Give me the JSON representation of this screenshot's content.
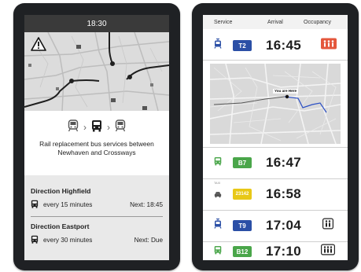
{
  "left_screen": {
    "clock": "18:30",
    "message": "Rail replacement bus services between Newhaven and Crossways",
    "directions": [
      {
        "title": "Direction Highfield",
        "frequency": "every 15 minutes",
        "next": "Next: 18:45"
      },
      {
        "title": "Direction Eastport",
        "frequency": "every 30 minutes",
        "next": "Next: Due"
      }
    ]
  },
  "right_screen": {
    "header": {
      "service": "Service",
      "arrival": "Arrival",
      "occupancy": "Occupancy"
    },
    "map_label": "You are Here",
    "rows": [
      {
        "mode": "tram-icon",
        "line": "T2",
        "time": "16:45",
        "occupancy": "high-occupancy-icon",
        "badge_color": "#2b4fa6"
      },
      {
        "mode": "bus-icon",
        "line": "B7",
        "time": "16:47",
        "occupancy": "",
        "badge_color": "#4aa64a"
      },
      {
        "mode": "taxi-icon",
        "line": "23142",
        "time": "16:58",
        "occupancy": "",
        "badge_color": "#e8c817",
        "mode_label": "TAXI"
      },
      {
        "mode": "tram-icon",
        "line": "T9",
        "time": "17:04",
        "occupancy": "medium-occupancy-icon",
        "badge_color": "#2b4fa6"
      },
      {
        "mode": "bus-icon",
        "line": "B12",
        "time": "17:10",
        "occupancy": "low-occupancy-icon",
        "badge_color": "#4aa64a"
      }
    ]
  },
  "colors": {
    "tram_blue": "#2b4fa6",
    "bus_green": "#4aa64a",
    "taxi_yellow": "#e8c817",
    "high_occupancy_red": "#e4573c"
  }
}
